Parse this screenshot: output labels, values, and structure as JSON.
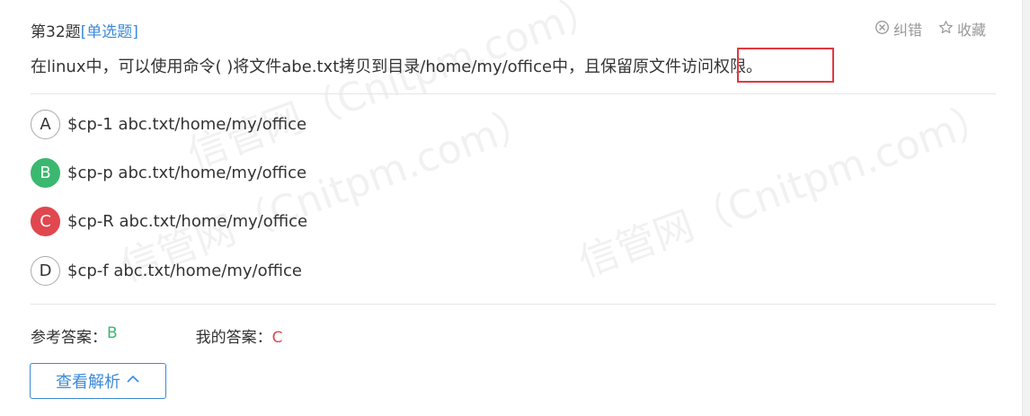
{
  "header": {
    "question_number": "第32题",
    "question_type": "[单选题]"
  },
  "actions": {
    "report_label": "纠错",
    "favorite_label": "收藏"
  },
  "question": {
    "text": "在linux中，可以使用命令( )将文件abe.txt拷贝到目录/home/my/office中，且保留原文件访问权限。"
  },
  "options": [
    {
      "letter": "A",
      "text": "$cp-1 abc.txt/home/my/office",
      "state": "normal"
    },
    {
      "letter": "B",
      "text": "$cp-p abc.txt/home/my/office",
      "state": "correct"
    },
    {
      "letter": "C",
      "text": "$cp-R abc.txt/home/my/office",
      "state": "wrong"
    },
    {
      "letter": "D",
      "text": "$cp-f abc.txt/home/my/office",
      "state": "normal"
    }
  ],
  "answers": {
    "reference_label": "参考答案：",
    "reference_value": "B",
    "mine_label": "我的答案：",
    "mine_value": "C"
  },
  "analysis_button": {
    "label": "查看解析"
  },
  "watermark": {
    "text": "信管网（Cnitpm.com）"
  },
  "colors": {
    "accent": "#3b8ad9",
    "correct": "#3bb86f",
    "wrong": "#e0474f",
    "highlight_border": "#e0393e"
  }
}
